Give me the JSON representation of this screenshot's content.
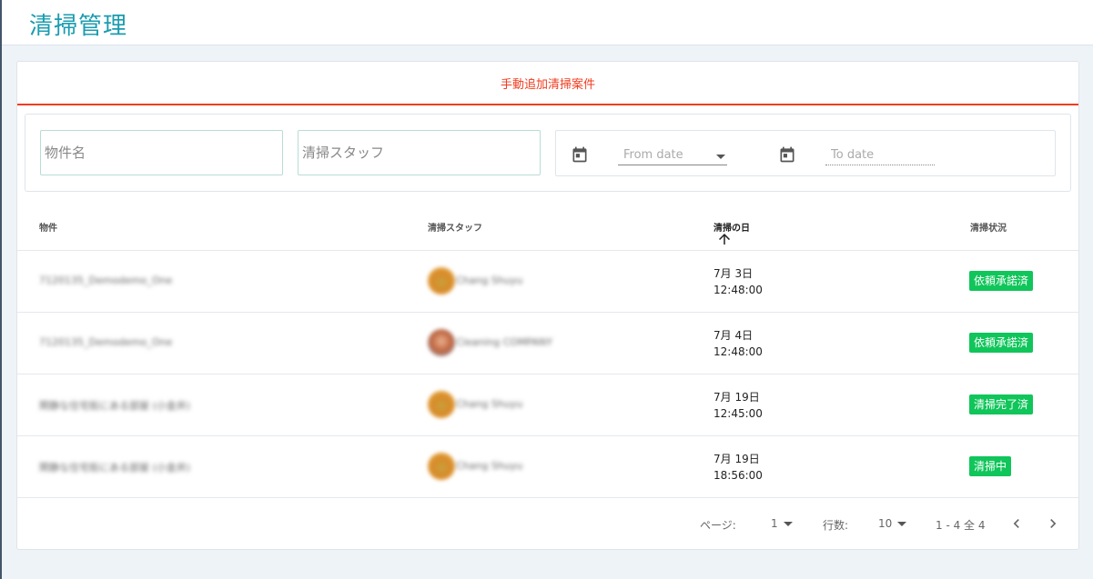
{
  "header": {
    "title": "清掃管理"
  },
  "tabs": [
    {
      "label": "手動追加清掃案件"
    }
  ],
  "filters": {
    "property_placeholder": "物件名",
    "staff_placeholder": "清掃スタッフ",
    "from_date_placeholder": "From date",
    "to_date_placeholder": "To date"
  },
  "table": {
    "columns": [
      "物件",
      "清掃スタッフ",
      "清掃の日",
      "清掃状況"
    ],
    "sort_column": "清掃の日",
    "sort_direction": "ascending",
    "rows": [
      {
        "property": "7120135_Demodemo_One",
        "staff": "Chang Shuyu",
        "date": "7月 3日",
        "time": "12:48:00",
        "status": "依頼承諾済"
      },
      {
        "property": "7120135_Demodemo_One",
        "staff": "Cleaning COMPANY",
        "date": "7月 4日",
        "time": "12:48:00",
        "status": "依頼承諾済"
      },
      {
        "property": "閑静な住宅街にある部屋 (小金井)",
        "staff": "Chang Shuyu",
        "date": "7月 19日",
        "time": "12:45:00",
        "status": "清掃完了済"
      },
      {
        "property": "閑静な住宅街にある部屋 (小金井)",
        "staff": "Chang Shuyu",
        "date": "7月 19日",
        "time": "18:56:00",
        "status": "清掃中"
      }
    ]
  },
  "pagination": {
    "page_label": "ページ:",
    "page_value": "1",
    "rows_label": "行数:",
    "rows_value": "10",
    "range_text": "1 - 4 全 4"
  },
  "colors": {
    "brand": "#1a9cb0",
    "tab_accent": "#f03c1e",
    "status_badge": "#10c55a"
  },
  "icons": [
    "calendar-icon",
    "arrow-up-icon",
    "chevron-down-icon",
    "chevron-left-icon",
    "chevron-right-icon"
  ]
}
